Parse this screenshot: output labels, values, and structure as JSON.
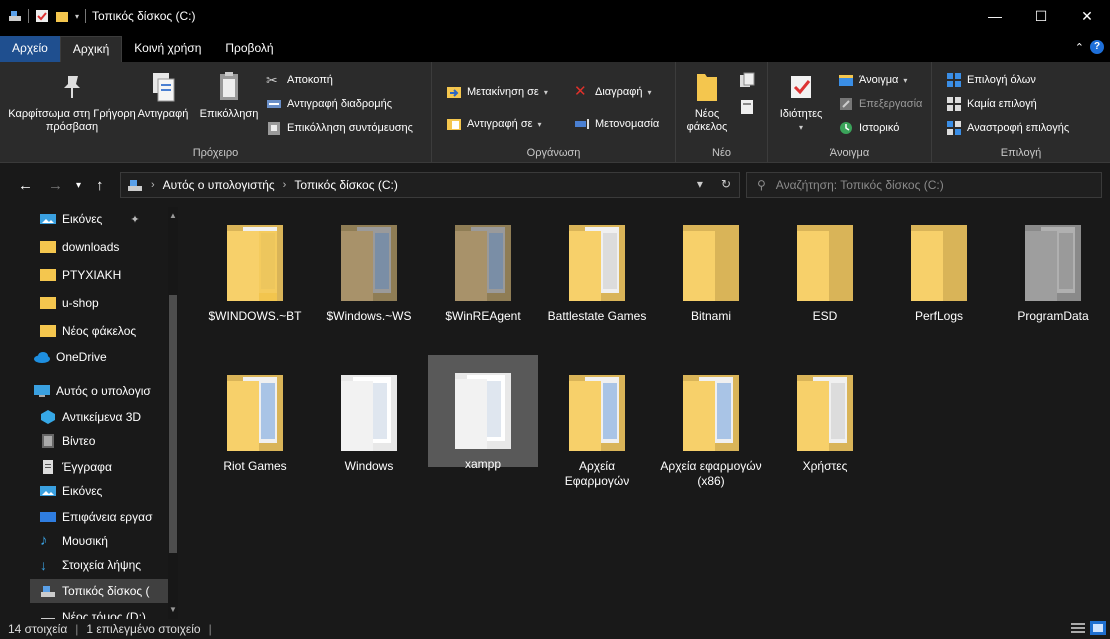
{
  "window": {
    "title": "Τοπικός δίσκος (C:)",
    "minimize": "—",
    "maximize": "☐",
    "close": "✕"
  },
  "tabs": {
    "file": "Αρχείο",
    "home": "Αρχική",
    "share": "Κοινή χρήση",
    "view": "Προβολή"
  },
  "ribbon": {
    "clipboard": {
      "label": "Πρόχειρο",
      "pin": "Καρφίτσωμα στη Γρήγορη πρόσβαση",
      "copy": "Αντιγραφή",
      "paste": "Επικόλληση",
      "cut": "Αποκοπή",
      "copy_path": "Αντιγραφή διαδρομής",
      "paste_shortcut": "Επικόλληση συντόμευσης"
    },
    "organize": {
      "label": "Οργάνωση",
      "move_to": "Μετακίνηση σε",
      "copy_to": "Αντιγραφή σε",
      "delete": "Διαγραφή",
      "rename": "Μετονομασία"
    },
    "new": {
      "label": "Νέο",
      "new_folder": "Νέος φάκελος"
    },
    "open": {
      "label": "Άνοιγμα",
      "properties": "Ιδιότητες",
      "open": "Άνοιγμα",
      "edit": "Επεξεργασία",
      "history": "Ιστορικό"
    },
    "select": {
      "label": "Επιλογή",
      "select_all": "Επιλογή όλων",
      "select_none": "Καμία επιλογή",
      "invert": "Αναστροφή επιλογής"
    }
  },
  "address": {
    "crumb1": "Αυτός ο υπολογιστής",
    "crumb2": "Τοπικός δίσκος (C:)",
    "search_placeholder": "Αναζήτηση: Τοπικός δίσκος (C:)"
  },
  "sidebar": {
    "items": [
      "Εικόνες",
      "downloads",
      "PTYXIAKH",
      "u-shop",
      "Νέος φάκελος",
      "OneDrive",
      "Αυτός ο υπολογισ",
      "Αντικείμενα 3D",
      "Βίντεο",
      "Έγγραφα",
      "Εικόνες",
      "Επιφάνεια εργασ",
      "Μουσική",
      "Στοιχεία λήψης",
      "Τοπικός δίσκος (",
      "Νέος τόμος (D:)"
    ]
  },
  "folders": [
    "$WINDOWS.~BT",
    "$Windows.~WS",
    "$WinREAgent",
    "Battlestate Games",
    "Bitnami",
    "ESD",
    "PerfLogs",
    "ProgramData",
    "Riot Games",
    "Windows",
    "xampp",
    "Αρχεία Εφαρμογών",
    "Αρχεία εφαρμογών (x86)",
    "Χρήστες"
  ],
  "status": {
    "count": "14 στοιχεία",
    "selected": "1 επιλεγμένο στοιχείο"
  },
  "colors": {
    "folder": "#f4c64e",
    "folder_hidden": "#a8926a",
    "accent": "#1f4f8f"
  }
}
